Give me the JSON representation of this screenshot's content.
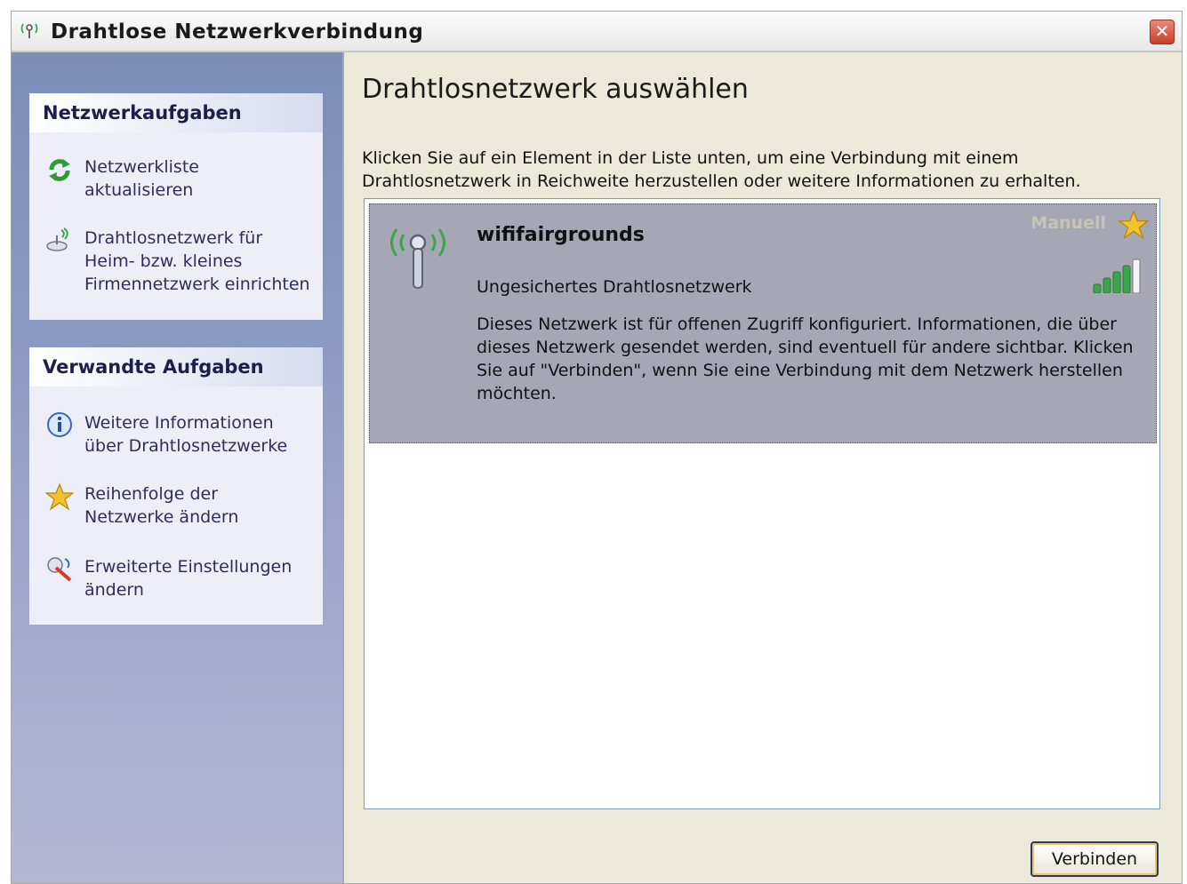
{
  "window": {
    "title": "Drahtlose Netzwerkverbindung",
    "close_glyph": "✕"
  },
  "sidebar": {
    "network_tasks": {
      "title": "Netzwerkaufgaben",
      "items": [
        {
          "label": "Netzwerkliste aktualisieren",
          "icon": "refresh-icon"
        },
        {
          "label": "Drahtlosnetzwerk für Heim- bzw. kleines Firmennetzwerk einrichten",
          "icon": "wireless-setup-icon"
        }
      ]
    },
    "related_tasks": {
      "title": "Verwandte Aufgaben",
      "items": [
        {
          "label": "Weitere Informationen über Drahtlosnetzwerke",
          "icon": "info-icon"
        },
        {
          "label": "Reihenfolge der Netzwerke ändern",
          "icon": "star-icon"
        },
        {
          "label": "Erweiterte Einstellungen ändern",
          "icon": "advanced-settings-icon"
        }
      ]
    }
  },
  "main": {
    "title": "Drahtlosnetzwerk auswählen",
    "description": "Klicken Sie auf ein Element in der Liste unten, um eine Verbindung mit einem Drahtlosnetzwerk in Reichweite herzustellen oder weitere Informationen zu erhalten.",
    "networks": [
      {
        "name": "wififairgrounds",
        "badge": "Manuell",
        "security": "Ungesichertes Drahtlosnetzwerk",
        "description": "Dieses Netzwerk ist für offenen Zugriff konfiguriert. Informationen, die über dieses Netzwerk gesendet werden, sind eventuell für andere sichtbar. Klicken Sie auf \"Verbinden\", wenn Sie eine Verbindung mit dem Netzwerk herstellen möchten.",
        "signal_bars": 4,
        "signal_max": 5
      }
    ],
    "connect_label": "Verbinden"
  },
  "colors": {
    "accent_green": "#3aa84a",
    "selection_gray": "#a5a8b4",
    "sidebar_gradient_top": "#7b8eb8",
    "sidebar_gradient_bottom": "#b3b7d4",
    "star_gold": "#f2c12e"
  }
}
